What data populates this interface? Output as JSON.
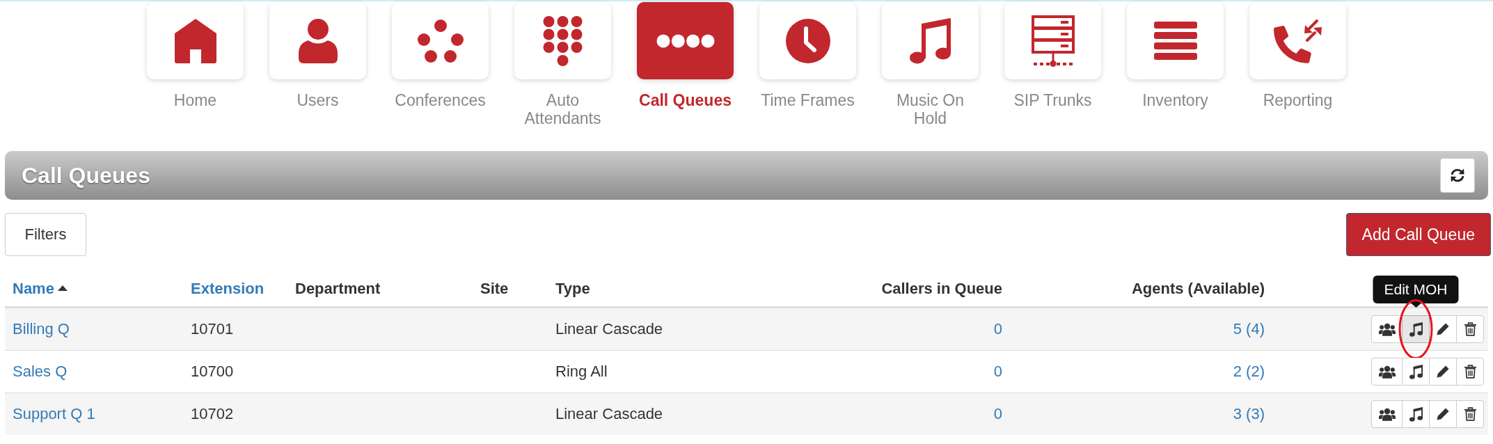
{
  "nav": [
    {
      "label": "Home",
      "selected": false
    },
    {
      "label": "Users",
      "selected": false
    },
    {
      "label": "Conferences",
      "selected": false
    },
    {
      "label": "Auto Attendants",
      "selected": false
    },
    {
      "label": "Call Queues",
      "selected": true
    },
    {
      "label": "Time Frames",
      "selected": false
    },
    {
      "label": "Music On Hold",
      "selected": false
    },
    {
      "label": "SIP Trunks",
      "selected": false
    },
    {
      "label": "Inventory",
      "selected": false
    },
    {
      "label": "Reporting",
      "selected": false
    }
  ],
  "panel": {
    "title": "Call Queues"
  },
  "toolbar": {
    "filters_button": "Filters",
    "add_button": "Add Call Queue"
  },
  "table": {
    "columns": [
      {
        "label": "Name",
        "sortable": true,
        "sorted": true
      },
      {
        "label": "Extension",
        "sortable": true,
        "sorted": false
      },
      {
        "label": "Department",
        "sortable": false,
        "sorted": false
      },
      {
        "label": "Site",
        "sortable": false,
        "sorted": false
      },
      {
        "label": "Type",
        "sortable": false,
        "sorted": false
      },
      {
        "label": "Callers in Queue",
        "sortable": false,
        "sorted": false
      },
      {
        "label": "Agents (Available)",
        "sortable": false,
        "sorted": false
      }
    ],
    "rows": [
      {
        "name": "Billing Q",
        "extension": "10701",
        "type": "Linear Cascade",
        "callers": "0",
        "agents": "5 (4)",
        "tooltip": "Edit MOH",
        "moh_hovered": true,
        "circled": true
      },
      {
        "name": "Sales Q",
        "extension": "10700",
        "type": "Ring All",
        "callers": "0",
        "agents": "2 (2)",
        "moh_hovered": false,
        "circled": false
      },
      {
        "name": "Support Q 1",
        "extension": "10702",
        "type": "Linear Cascade",
        "callers": "0",
        "agents": "3 (3)",
        "moh_hovered": false,
        "circled": false
      }
    ]
  }
}
